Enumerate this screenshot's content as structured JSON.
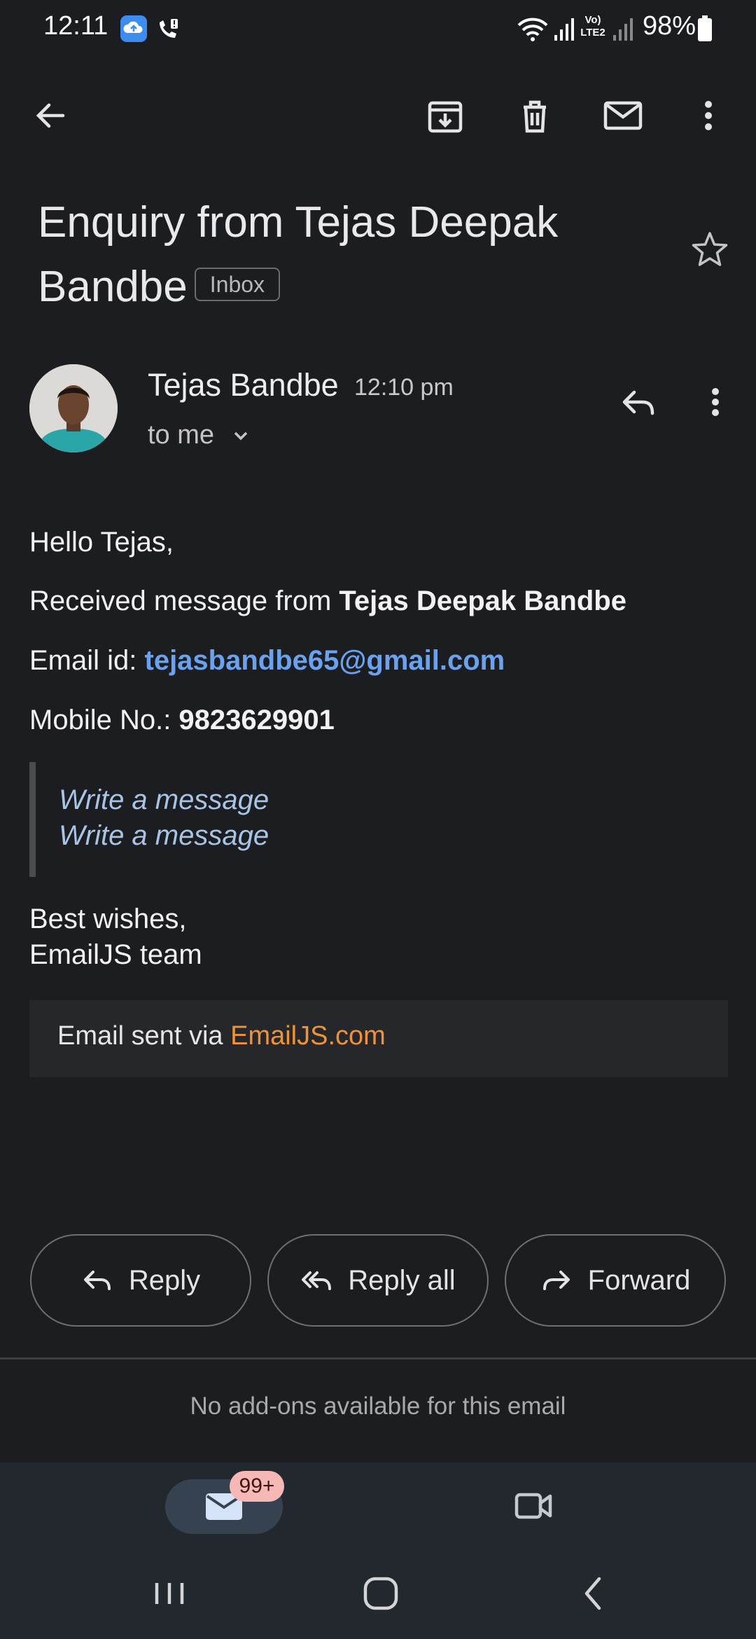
{
  "status_bar": {
    "time": "12:11",
    "battery": "98%",
    "network_label": "Vo) LTE2"
  },
  "toolbar": {
    "back": "arrow-back-icon",
    "archive": "archive-icon",
    "delete": "delete-icon",
    "mark_unread": "mail-icon",
    "more": "more-vert-icon"
  },
  "email": {
    "subject": "Enquiry from Tejas Deepak Bandbe",
    "label_chip": "Inbox",
    "sender_name": "Tejas Bandbe",
    "time": "12:10 pm",
    "recipient": "to me",
    "greeting": "Hello Tejas,",
    "received_prefix": "Received message from ",
    "received_name": "Tejas Deepak Bandbe",
    "email_label": "Email id: ",
    "email_value": "tejasbandbe65@gmail.com",
    "mobile_label": "Mobile No.: ",
    "mobile_value": "9823629901",
    "quote_lines": [
      "Write a message",
      "Write a message"
    ],
    "signoff_1": "Best wishes,",
    "signoff_2": "EmailJS team",
    "footer_prefix": "Email sent via ",
    "footer_link": "EmailJS.com"
  },
  "actions": {
    "reply": "Reply",
    "reply_all": "Reply all",
    "forward": "Forward"
  },
  "addons_text": "No add-ons available for this email",
  "bottom_nav": {
    "mail_badge": "99+"
  },
  "colors": {
    "background": "#1b1d21",
    "link": "#6aa2f0",
    "footer_link": "#f0923a",
    "badge": "#f6b8b4"
  }
}
